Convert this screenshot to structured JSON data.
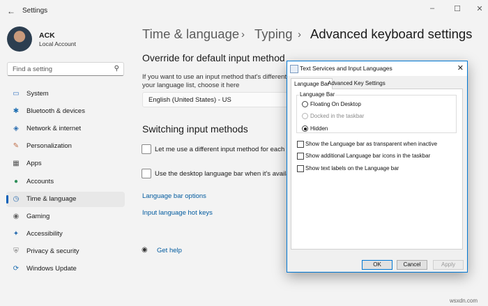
{
  "window": {
    "title": "Settings",
    "back": "←",
    "controls": [
      "–",
      "☐",
      "✕"
    ]
  },
  "user": {
    "name": "ACK",
    "account": "Local Account"
  },
  "search": {
    "placeholder": "Find a setting"
  },
  "sidebar": {
    "items": [
      {
        "label": "System",
        "icon": "display-icon",
        "glyph": "▭",
        "color": "#3a78c2"
      },
      {
        "label": "Bluetooth & devices",
        "icon": "bluetooth-icon",
        "glyph": "✱",
        "color": "#1f6fb2"
      },
      {
        "label": "Network & internet",
        "icon": "wifi-icon",
        "glyph": "◈",
        "color": "#2a6db0"
      },
      {
        "label": "Personalization",
        "icon": "brush-icon",
        "glyph": "✎",
        "color": "#c0704a"
      },
      {
        "label": "Apps",
        "icon": "apps-icon",
        "glyph": "▦",
        "color": "#555555"
      },
      {
        "label": "Accounts",
        "icon": "person-icon",
        "glyph": "●",
        "color": "#2f8f5a"
      },
      {
        "label": "Time & language",
        "icon": "globe-clock-icon",
        "glyph": "◷",
        "color": "#2a6db0",
        "selected": true
      },
      {
        "label": "Gaming",
        "icon": "gamepad-icon",
        "glyph": "◉",
        "color": "#666666"
      },
      {
        "label": "Accessibility",
        "icon": "accessibility-icon",
        "glyph": "✦",
        "color": "#2a6db0"
      },
      {
        "label": "Privacy & security",
        "icon": "shield-icon",
        "glyph": "⛨",
        "color": "#777777"
      },
      {
        "label": "Windows Update",
        "icon": "update-icon",
        "glyph": "⟳",
        "color": "#1f6fb2"
      }
    ]
  },
  "breadcrumb": {
    "part1": "Time & language",
    "part2": "Typing",
    "current": "Advanced keyboard settings",
    "sep": "›"
  },
  "override": {
    "heading": "Override for default input method",
    "description_line1": "If you want to use an input method that's different th",
    "description_line2": "your language list, choose it here",
    "dropdown_value": "English (United States) - US"
  },
  "switching": {
    "heading": "Switching input methods",
    "option1": "Let me use a different input method for each app",
    "option2": "Use the desktop language bar when it's available",
    "link1": "Language bar options",
    "link2": "Input language hot keys"
  },
  "help": {
    "label": "Get help"
  },
  "dialog": {
    "title": "Text Services and Input Languages",
    "tabs": [
      "Language Bar",
      "Advanced Key Settings"
    ],
    "group_label": "Language Bar",
    "radios": [
      {
        "label": "Floating On Desktop",
        "state": "off"
      },
      {
        "label": "Docked in the taskbar",
        "state": "disabled"
      },
      {
        "label": "Hidden",
        "state": "on"
      }
    ],
    "checkboxes": [
      "Show the Language bar as transparent when inactive",
      "Show additional Language bar icons in the taskbar",
      "Show text labels on the Language bar"
    ],
    "buttons": {
      "ok": "OK",
      "cancel": "Cancel",
      "apply": "Apply"
    }
  },
  "watermark": "wsxdn.com"
}
